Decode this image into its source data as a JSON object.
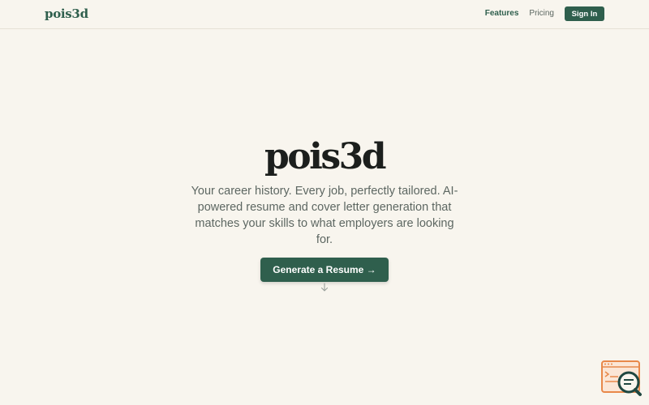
{
  "header": {
    "brand": "pois3d",
    "nav": {
      "features": "Features",
      "pricing": "Pricing"
    },
    "sign_in": "Sign In"
  },
  "hero": {
    "title": "pois3d",
    "subtitle": "Your career history. Every job, perfectly tailored. AI-powered resume and cover letter generation that matches your skills to what employers are looking for.",
    "cta": "Generate a Resume →"
  },
  "icons": {
    "scroll": "arrow-down-icon",
    "widget": "resume-search-icon"
  },
  "colors": {
    "background": "#f8f5ee",
    "accent": "#2f5f4d",
    "widget": "#e8884a"
  }
}
